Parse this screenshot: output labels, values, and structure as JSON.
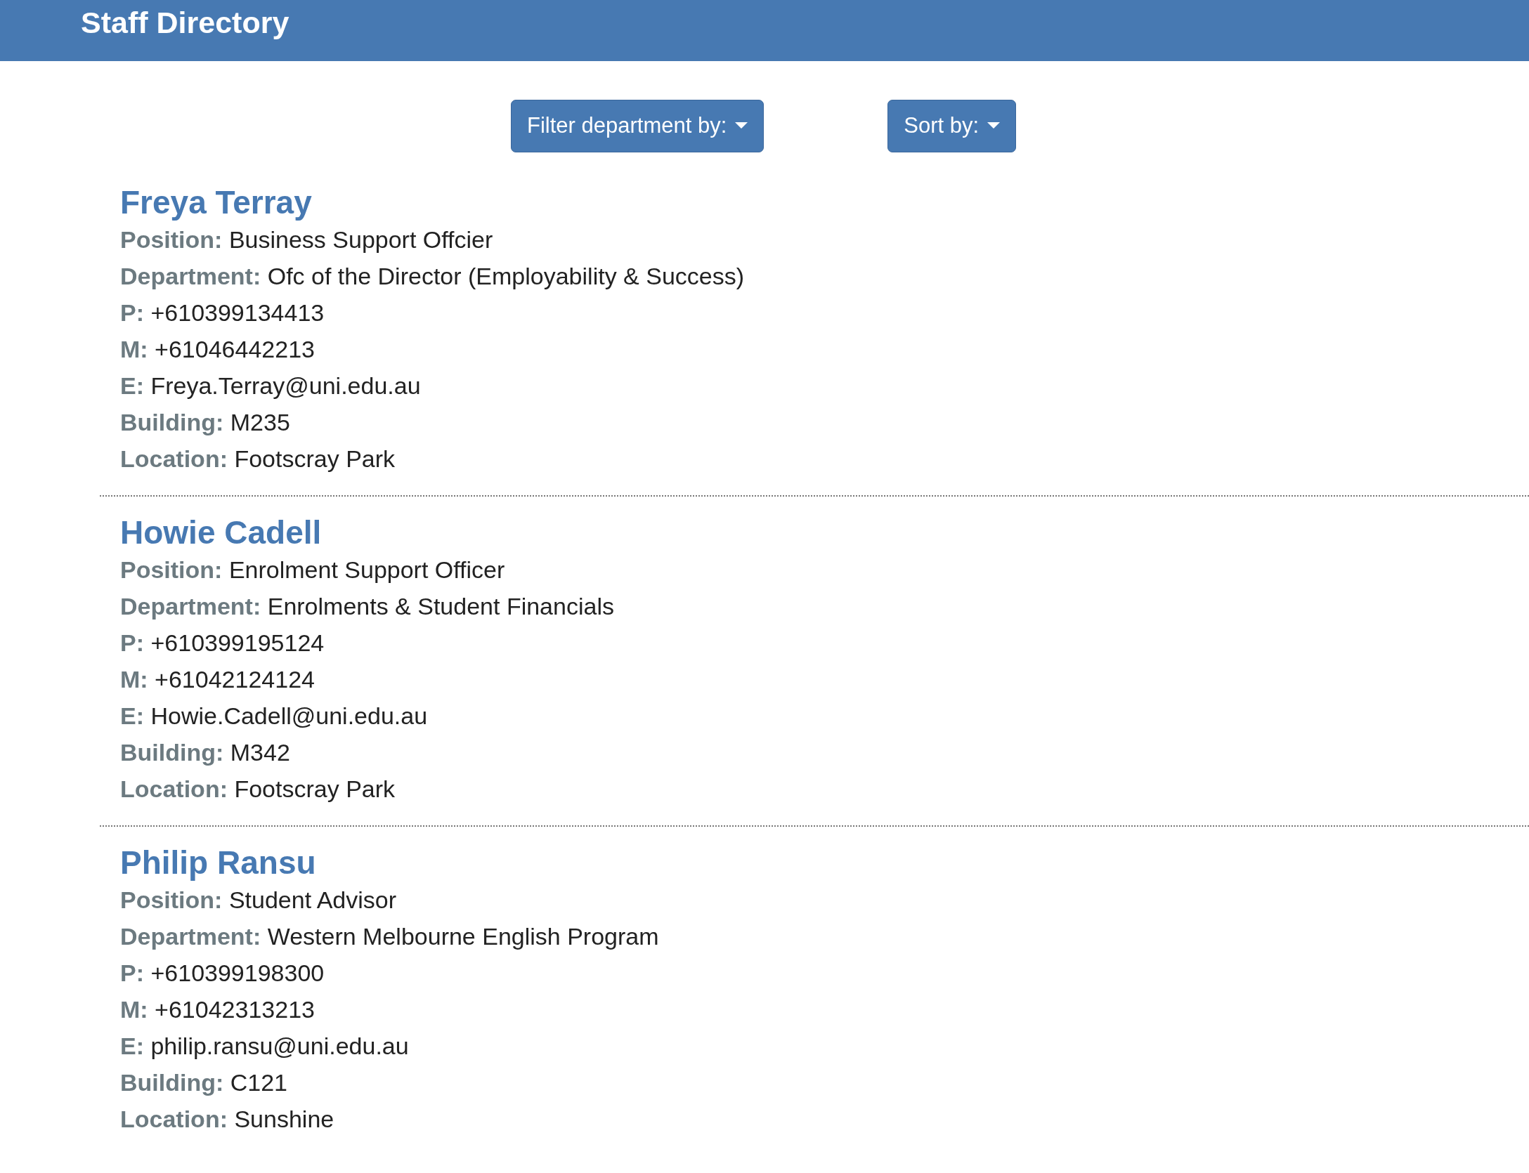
{
  "header": {
    "title": "Staff Directory"
  },
  "toolbar": [
    {
      "label": "Filter department by:"
    },
    {
      "label": "Sort by:"
    }
  ],
  "staff": [
    {
      "name": "Freya Terray",
      "fields": [
        {
          "label": "Position:",
          "value": "Business Support Offcier"
        },
        {
          "label": "Department:",
          "value": "Ofc of the Director (Employability & Success)"
        },
        {
          "label": "P:",
          "value": "+610399134413"
        },
        {
          "label": "M:",
          "value": "+61046442213"
        },
        {
          "label": "E:",
          "value": "Freya.Terray@uni.edu.au"
        },
        {
          "label": "Building:",
          "value": "M235"
        },
        {
          "label": "Location:",
          "value": "Footscray Park"
        }
      ]
    },
    {
      "name": "Howie Cadell",
      "fields": [
        {
          "label": "Position:",
          "value": "Enrolment Support Officer"
        },
        {
          "label": "Department:",
          "value": "Enrolments & Student Financials"
        },
        {
          "label": "P:",
          "value": "+610399195124"
        },
        {
          "label": "M:",
          "value": "+61042124124"
        },
        {
          "label": "E:",
          "value": "Howie.Cadell@uni.edu.au"
        },
        {
          "label": "Building:",
          "value": "M342"
        },
        {
          "label": "Location:",
          "value": "Footscray Park"
        }
      ]
    },
    {
      "name": "Philip Ransu",
      "fields": [
        {
          "label": "Position:",
          "value": "Student Advisor"
        },
        {
          "label": "Department:",
          "value": "Western Melbourne English Program"
        },
        {
          "label": "P:",
          "value": "+610399198300"
        },
        {
          "label": "M:",
          "value": "+61042313213"
        },
        {
          "label": "E:",
          "value": "philip.ransu@uni.edu.au"
        },
        {
          "label": "Building:",
          "value": "C121"
        },
        {
          "label": "Location:",
          "value": "Sunshine"
        }
      ]
    }
  ]
}
